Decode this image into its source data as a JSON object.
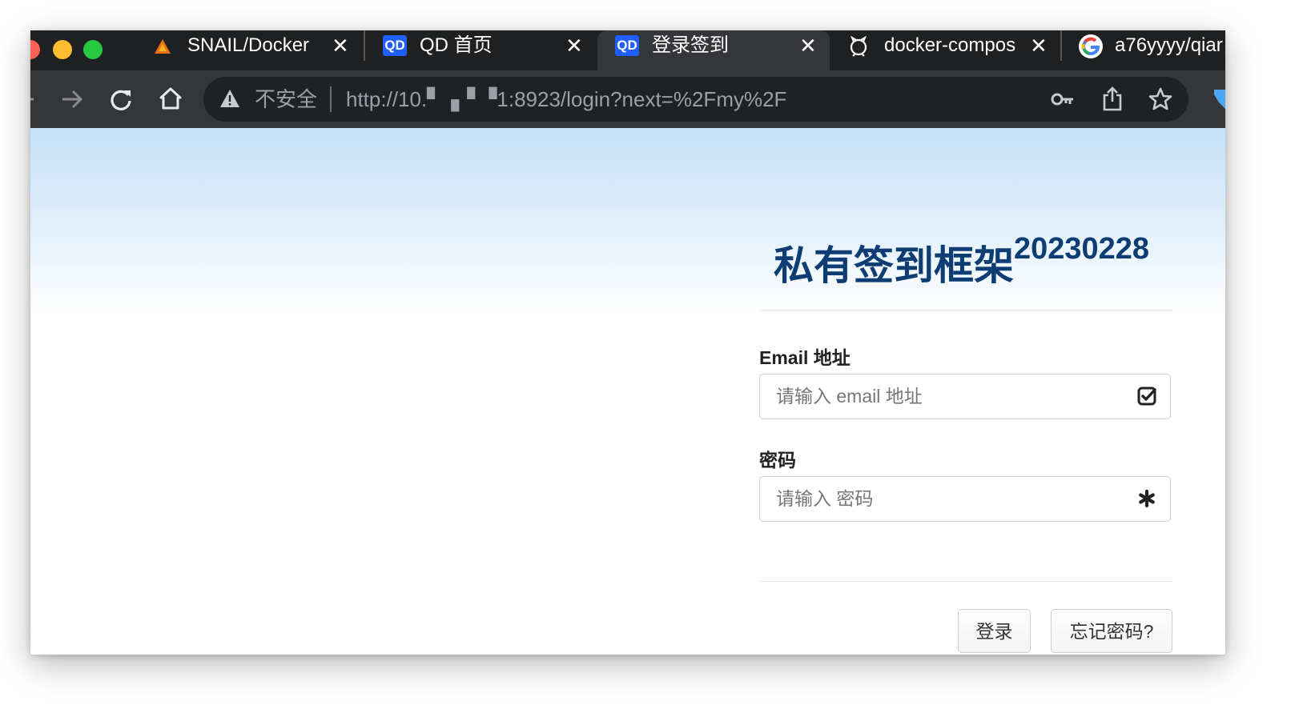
{
  "browser": {
    "tabs": [
      {
        "title": "SNAIL/Docker",
        "icon": "warning-triangle-icon",
        "active": false
      },
      {
        "title": "QD 首页",
        "icon": "qd-logo-icon",
        "icon_text": "QD",
        "active": false
      },
      {
        "title": "登录签到",
        "icon": "qd-logo-icon",
        "icon_text": "QD",
        "active": true
      },
      {
        "title": "docker-compos",
        "icon": "github-icon",
        "active": false
      },
      {
        "title": "a76yyyy/qiar",
        "icon": "google-icon",
        "active": false
      }
    ],
    "close_glyph": "✕",
    "address_bar": {
      "security_label": "不安全",
      "url": "http://10.▘▗▝ ▝1:8923/login?next=%2Fmy%2F"
    }
  },
  "page": {
    "title": "私有签到框架",
    "title_version": "20230228",
    "email": {
      "label": "Email 地址",
      "placeholder": "请输入 email 地址",
      "value": ""
    },
    "password": {
      "label": "密码",
      "placeholder": "请输入 密码",
      "value": ""
    },
    "login_button": "登录",
    "forgot_button": "忘记密码?"
  },
  "colors": {
    "title": "#0d3d73",
    "gradient_top": "#c6e1f7",
    "tab_bar": "#1f2021",
    "toolbar": "#35363a",
    "qd_badge": "#1f5fff"
  }
}
